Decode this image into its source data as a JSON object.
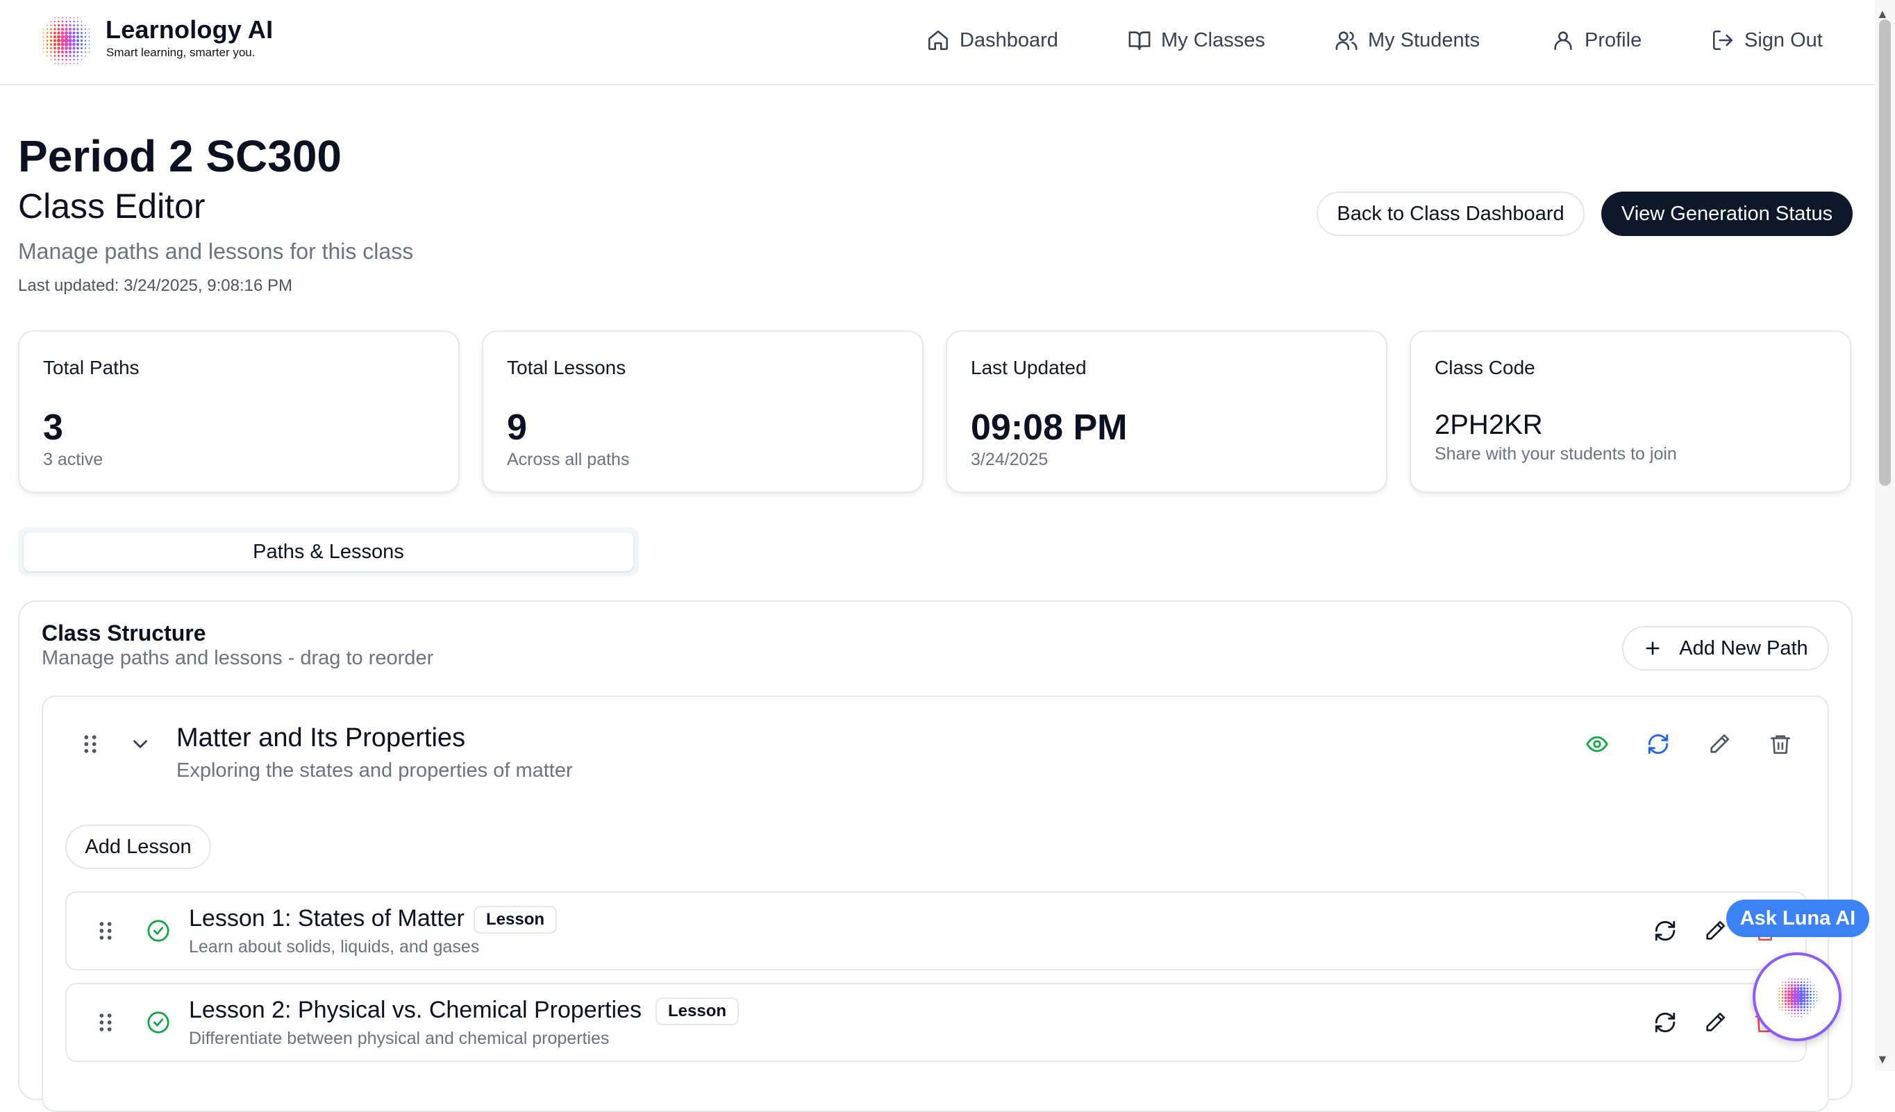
{
  "brand": {
    "name": "Learnology AI",
    "tagline": "Smart learning, smarter you."
  },
  "nav": {
    "dashboard": "Dashboard",
    "my_classes": "My Classes",
    "my_students": "My Students",
    "profile": "Profile",
    "sign_out": "Sign Out"
  },
  "page": {
    "title": "Period 2 SC300",
    "subtitle": "Class Editor",
    "description": "Manage paths and lessons for this class",
    "last_updated": "Last updated: 3/24/2025, 9:08:16 PM",
    "back_button": "Back to Class Dashboard",
    "status_button": "View Generation Status"
  },
  "stats": {
    "paths": {
      "label": "Total Paths",
      "value": "3",
      "sub": "3 active"
    },
    "lessons": {
      "label": "Total Lessons",
      "value": "9",
      "sub": "Across all paths"
    },
    "updated": {
      "label": "Last Updated",
      "value": "09:08 PM",
      "sub": "3/24/2025"
    },
    "code": {
      "label": "Class Code",
      "value": "2PH2KR",
      "sub": "Share with your students to join"
    }
  },
  "tabs": {
    "active": "Paths & Lessons"
  },
  "structure": {
    "title": "Class Structure",
    "subtitle": "Manage paths and lessons - drag to reorder",
    "add_path": "Add New Path",
    "path": {
      "title": "Matter and Its Properties",
      "description": "Exploring the states and properties of matter",
      "add_lesson": "Add Lesson",
      "lessons": [
        {
          "title": "Lesson 1: States of Matter",
          "badge": "Lesson",
          "description": "Learn about solids, liquids, and gases"
        },
        {
          "title": "Lesson 2: Physical vs. Chemical Properties",
          "badge": "Lesson",
          "description": "Differentiate between physical and chemical properties"
        }
      ]
    }
  },
  "assistant": {
    "label": "Ask Luna AI"
  },
  "colors": {
    "accent_dark": "#0f172a",
    "success": "#16a34a",
    "refresh": "#2563eb",
    "assistant": "#3b82f6",
    "danger": "#ef4444"
  }
}
